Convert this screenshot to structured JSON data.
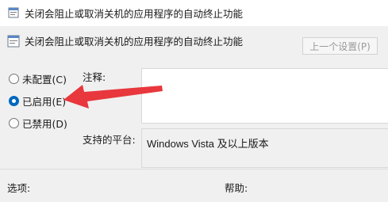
{
  "window": {
    "title": "关闭会阻止或取消关机的应用程序的自动终止功能"
  },
  "header": {
    "setting_name": "关闭会阻止或取消关机的应用程序的自动终止功能",
    "prev_setting_label": "上一个设置(P)"
  },
  "state_options": [
    {
      "label": "未配置(C)",
      "checked": false
    },
    {
      "label": "已启用(E)",
      "checked": true
    },
    {
      "label": "已禁用(D)",
      "checked": false
    }
  ],
  "comment": {
    "label": "注释:",
    "value": ""
  },
  "supported": {
    "label": "支持的平台:",
    "value": "Windows Vista 及以上版本"
  },
  "sections": {
    "options_label": "选项:",
    "help_label": "帮助:"
  },
  "colors": {
    "accent": "#0067c0",
    "annotation_arrow": "#e8373d"
  }
}
